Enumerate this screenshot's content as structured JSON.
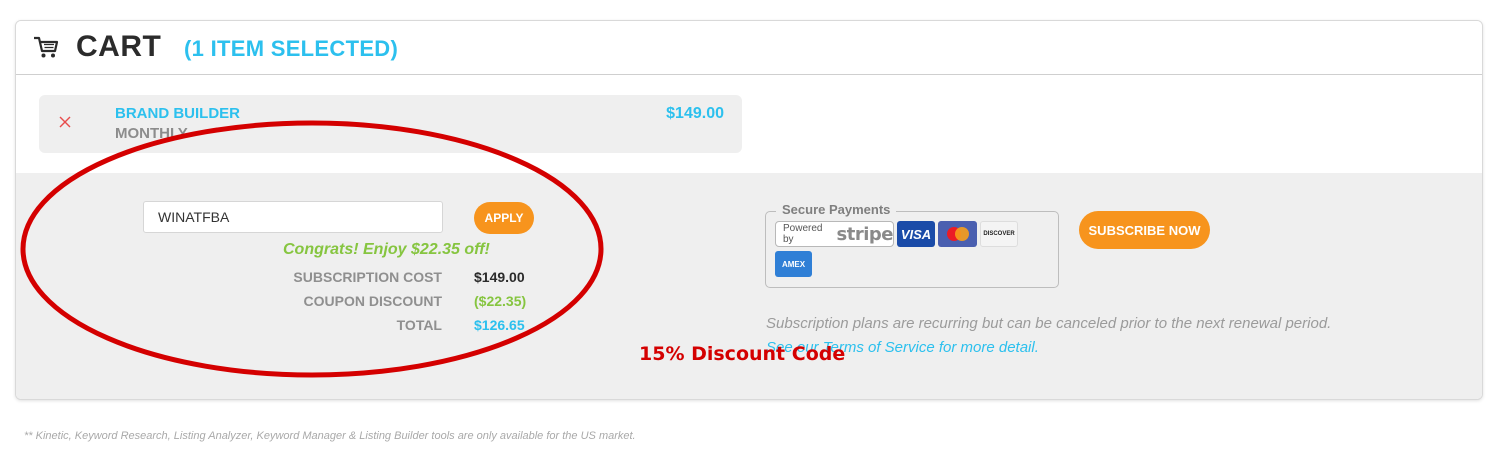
{
  "cart": {
    "title": "CART",
    "count_label": "(1 ITEM SELECTED)",
    "icon": "shopping-cart-icon"
  },
  "item": {
    "name": "BRAND BUILDER",
    "plan": "MONTHLY",
    "price": "$149.00",
    "remove_icon": "close-icon"
  },
  "coupon": {
    "value": "WINATFBA",
    "apply_label": "APPLY",
    "success_message": "Congrats! Enjoy $22.35 off!"
  },
  "summary": {
    "rows": [
      {
        "label": "SUBSCRIPTION COST",
        "value": "$149.00",
        "color": "#2b2b2b"
      },
      {
        "label": "COUPON DISCOUNT",
        "value": "($22.35)",
        "color": "#86c540"
      },
      {
        "label": "TOTAL",
        "value": "$126.65",
        "color": "#2cc0ee"
      }
    ]
  },
  "annotation": {
    "discount_note": "15% Discount Code",
    "circle_color": "#d40000"
  },
  "payments": {
    "legend": "Secure Payments",
    "stripe_prefix": "Powered by",
    "stripe_word": "stripe",
    "visa": "VISA",
    "discover": "DISCOVER",
    "amex": "AMEX"
  },
  "subscribe_label": "SUBSCRIBE NOW",
  "recurring_note": "Subscription plans are recurring but can be canceled prior to the next renewal period.",
  "tos_link": "See our Terms of Service for more detail.",
  "footnote": "** Kinetic, Keyword Research, Listing Analyzer, Keyword Manager & Listing Builder tools are only available for the US market.",
  "colors": {
    "accent_blue": "#2cc0ee",
    "accent_orange": "#f7941d",
    "success_green": "#86c540"
  }
}
